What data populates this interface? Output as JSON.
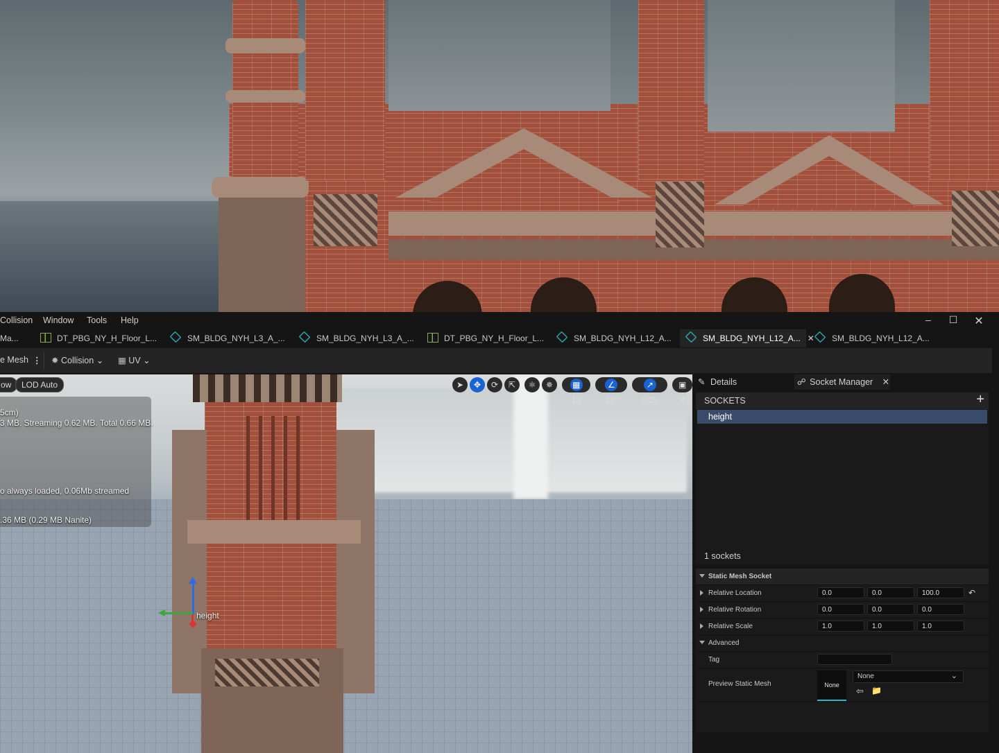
{
  "menu": {
    "items": [
      "Collision",
      "Window",
      "Tools",
      "Help"
    ]
  },
  "tabs": [
    {
      "label": "Ma...",
      "icon": "mesh-icon"
    },
    {
      "label": "DT_PBG_NY_H_Floor_L...",
      "icon": "data-table-icon"
    },
    {
      "label": "SM_BLDG_NYH_L3_A_...",
      "icon": "static-mesh-icon"
    },
    {
      "label": "SM_BLDG_NYH_L3_A_...",
      "icon": "static-mesh-icon"
    },
    {
      "label": "DT_PBG_NY_H_Floor_L...",
      "icon": "data-table-icon"
    },
    {
      "label": "SM_BLDG_NYH_L12_A...",
      "icon": "static-mesh-icon"
    },
    {
      "label": "SM_BLDG_NYH_L12_A...",
      "icon": "static-mesh-icon",
      "active": true
    },
    {
      "label": "SM_BLDG_NYH_L12_A...",
      "icon": "static-mesh-icon"
    }
  ],
  "toolbar": {
    "mesh_label": "e Mesh",
    "collision_label": "Collision",
    "uv_label": "UV"
  },
  "viewport": {
    "view_pill": "ow",
    "lod_pill": "LOD Auto",
    "stats": [
      "5cm)",
      "3 MB. Streaming 0.62 MB. Total 0.66 MB.",
      "o always loaded, 0.06Mb streamed",
      ".36 MB (0.29 MB Nanite)"
    ],
    "grid_snap": "10",
    "rotation_snap": "10°",
    "scale_snap": "0.25",
    "camera_speed": "4",
    "socket_label": "height"
  },
  "panel": {
    "tab_details": "Details",
    "tab_socket_manager": "Socket Manager",
    "sockets_header": "SOCKETS",
    "socket_name": "height",
    "socket_count": "1 sockets",
    "section_title": "Static Mesh Socket",
    "relative_location": {
      "label": "Relative Location",
      "x": "0.0",
      "y": "0.0",
      "z": "100.0"
    },
    "relative_rotation": {
      "label": "Relative Rotation",
      "x": "0.0",
      "y": "0.0",
      "z": "0.0"
    },
    "relative_scale": {
      "label": "Relative Scale",
      "x": "1.0",
      "y": "1.0",
      "z": "1.0"
    },
    "advanced_label": "Advanced",
    "tag_label": "Tag",
    "tag_value": "",
    "preview_label": "Preview Static Mesh",
    "preview_thumb": "None",
    "preview_select": "None"
  },
  "colors": {
    "accent_blue": "#1a63d4",
    "selection": "#394b68",
    "teal": "#2aa9b8"
  }
}
